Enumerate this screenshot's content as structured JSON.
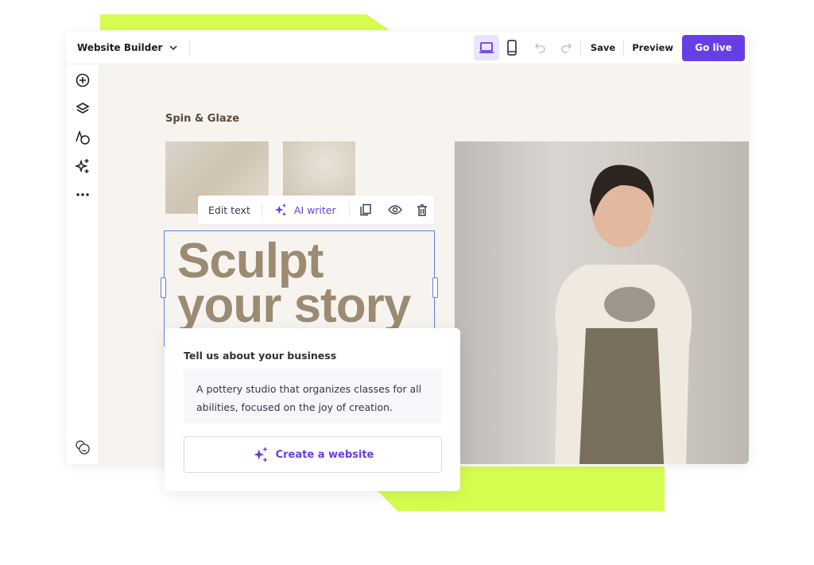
{
  "header": {
    "app_title": "Website Builder",
    "save_label": "Save",
    "preview_label": "Preview",
    "go_live_label": "Go live"
  },
  "canvas": {
    "site_name": "Spin & Glaze",
    "heading_line1": "Sculpt",
    "heading_line2": "your story"
  },
  "text_toolbar": {
    "edit_text_label": "Edit text",
    "ai_writer_label": "AI writer"
  },
  "ai_card": {
    "title": "Tell us about your business",
    "description": "A pottery studio that organizes classes for all abilities, focused on the joy of creation.",
    "button_label": "Create a website"
  },
  "colors": {
    "accent": "#673de6",
    "highlight": "#d5fd50",
    "heading": "#9c8a72",
    "selection": "#5e7fe8"
  }
}
